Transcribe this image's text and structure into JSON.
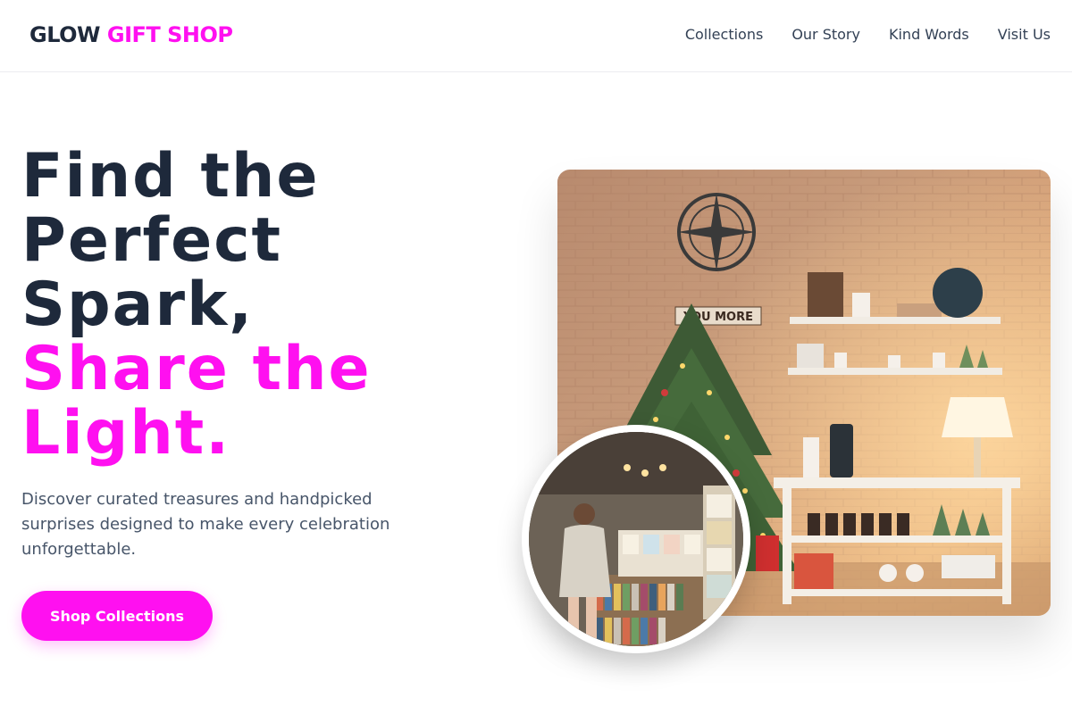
{
  "brand": {
    "part1": "GLOW",
    "part2": "GIFT SHOP"
  },
  "nav": {
    "items": [
      {
        "label": "Collections"
      },
      {
        "label": "Our Story"
      },
      {
        "label": "Kind Words"
      },
      {
        "label": "Visit Us"
      }
    ]
  },
  "hero": {
    "headline_dark": [
      "Find the",
      "Perfect",
      "Spark,"
    ],
    "headline_pink": [
      "Share the",
      "Light."
    ],
    "subtext": "Discover curated treasures and handpicked surprises designed to make every celebration unforgettable.",
    "cta_label": "Shop Collections",
    "sign_text": "YOU MORE"
  },
  "colors": {
    "accent": "#ff10f0",
    "heading": "#1e293b",
    "body_text": "#475569"
  }
}
